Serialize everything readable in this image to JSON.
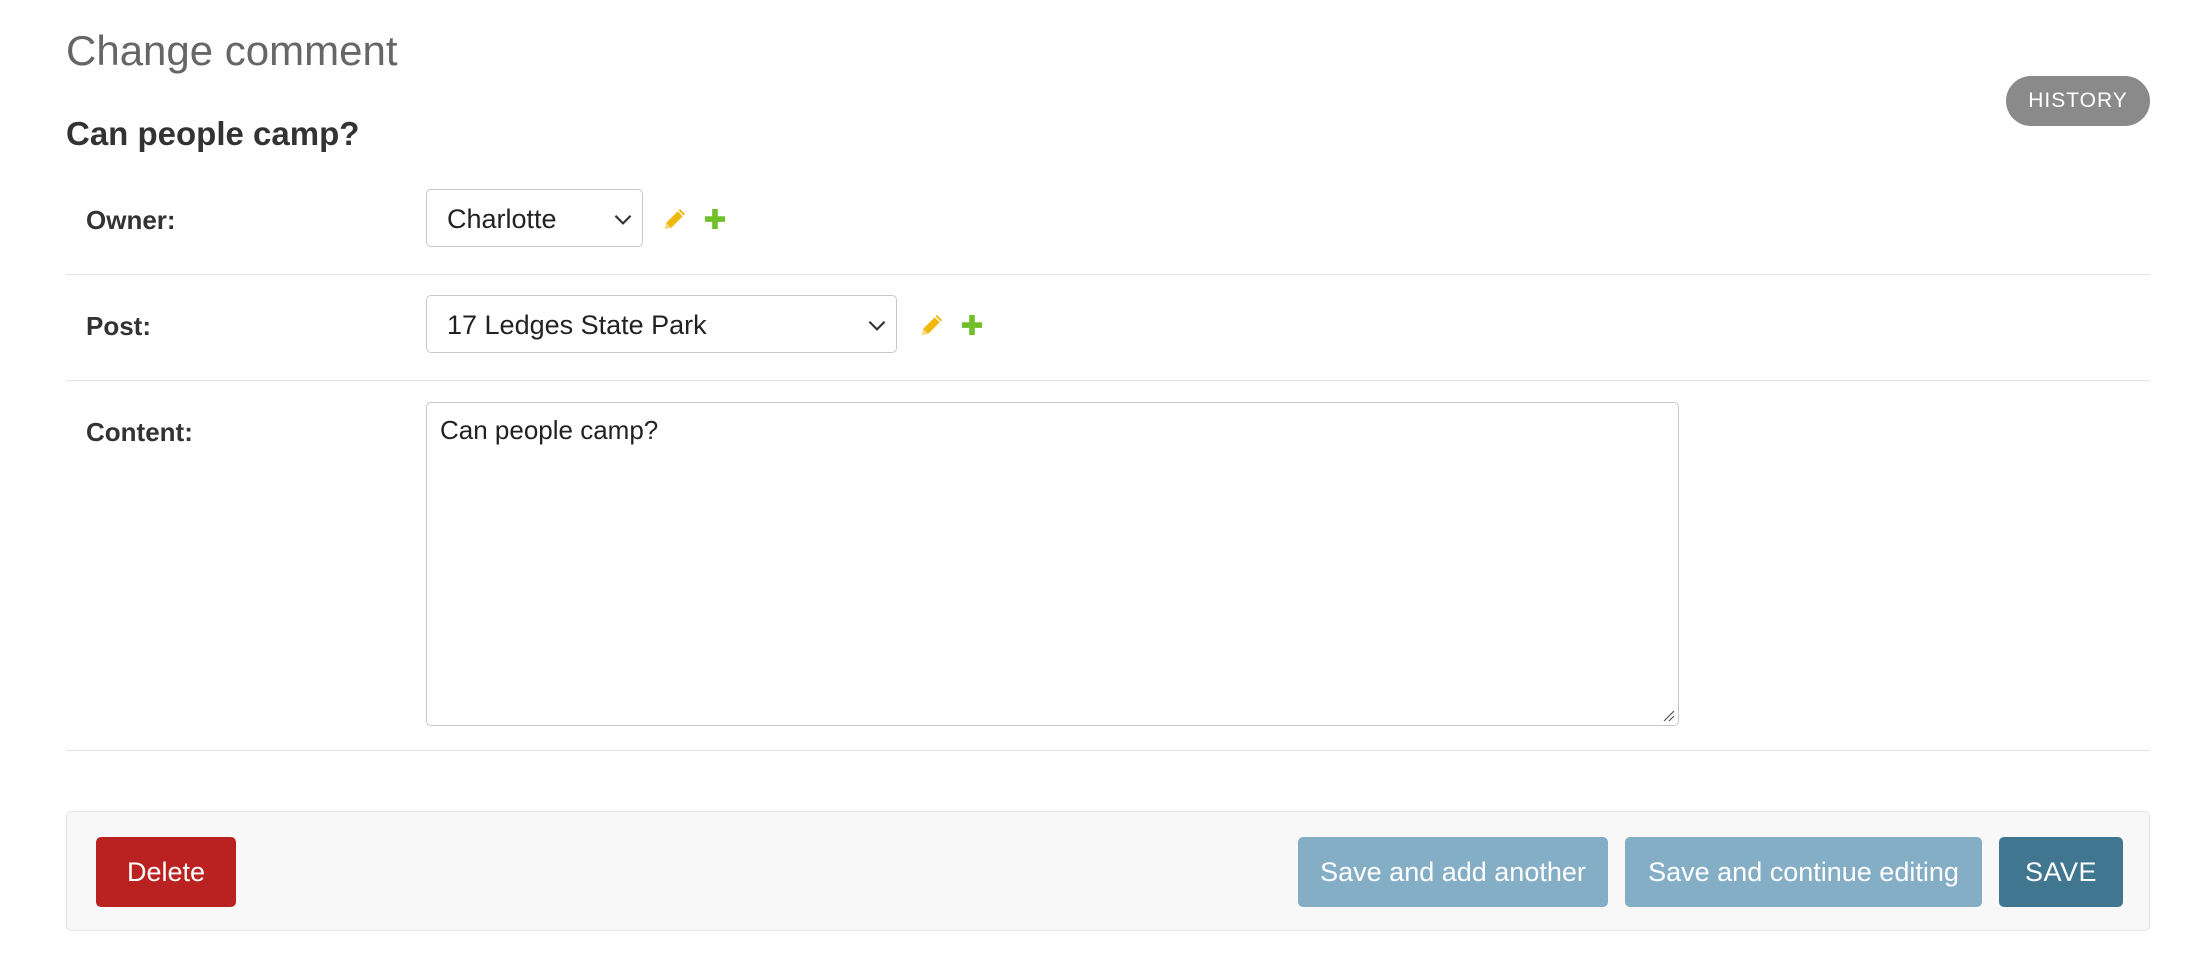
{
  "page": {
    "title": "Change comment",
    "history_label": "HISTORY",
    "object_title": "Can people camp?"
  },
  "form": {
    "owner": {
      "label": "Owner:",
      "value": "Charlotte"
    },
    "post": {
      "label": "Post:",
      "value": "17 Ledges State Park"
    },
    "content": {
      "label": "Content:",
      "value": "Can people camp?"
    }
  },
  "actions": {
    "delete_label": "Delete",
    "save_add_label": "Save and add another",
    "save_continue_label": "Save and continue editing",
    "save_label": "SAVE"
  },
  "colors": {
    "delete": "#ba2121",
    "secondary_save": "#84aec6",
    "primary_save": "#417690",
    "edit_icon": "#efb80b",
    "add_icon": "#70bf2b",
    "history": "#8a8a8a"
  },
  "icons": {
    "edit": "pencil-icon",
    "add": "plus-icon",
    "dropdown": "chevron-down-icon",
    "resize": "resize-handle-icon"
  }
}
